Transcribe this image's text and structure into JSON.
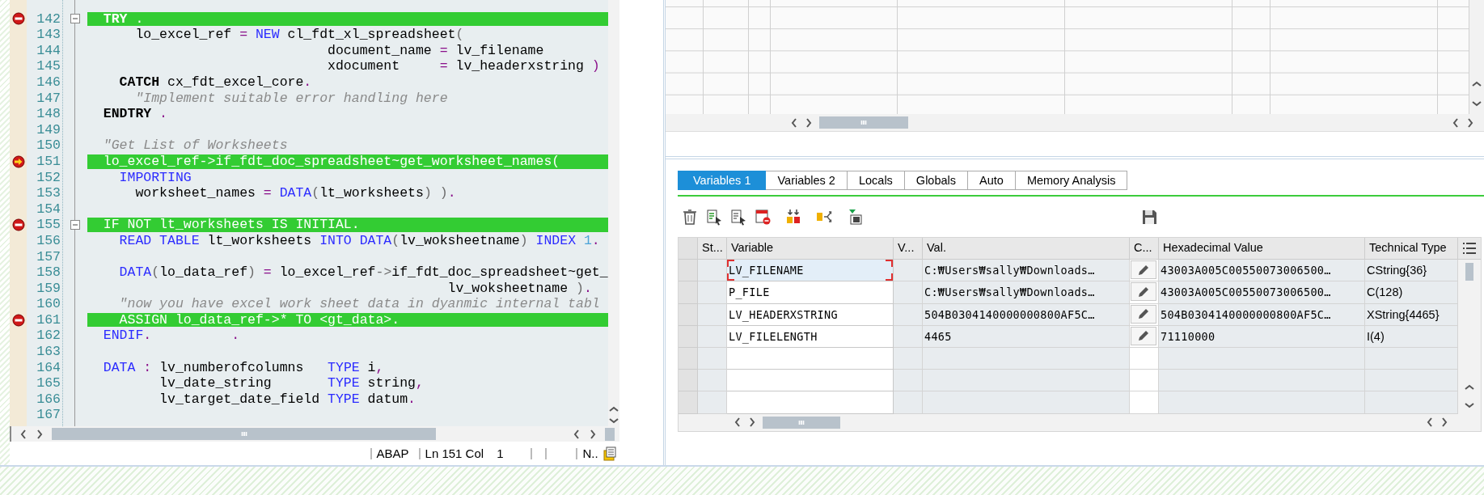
{
  "editor": {
    "lines": [
      {
        "number": "142",
        "highlighted": true,
        "breakpoint": true,
        "current_line": false,
        "collapsible": true,
        "segments": [
          {
            "text": "  TRY",
            "kind": "bold"
          },
          {
            "text": " .",
            "kind": "op"
          }
        ]
      },
      {
        "number": "143",
        "highlighted": false,
        "breakpoint": false,
        "current_line": false,
        "collapsible": false,
        "segments": [
          {
            "text": "      lo_excel_ref ",
            "kind": "ident"
          },
          {
            "text": "=",
            "kind": "op"
          },
          {
            "text": " NEW",
            "kind": "keyword"
          },
          {
            "text": " cl_fdt_xl_spreadsheet",
            "kind": "ident"
          },
          {
            "text": "(",
            "kind": "paren"
          }
        ]
      },
      {
        "number": "144",
        "highlighted": false,
        "breakpoint": false,
        "current_line": false,
        "collapsible": false,
        "segments": [
          {
            "text": "                              document_name ",
            "kind": "ident"
          },
          {
            "text": "=",
            "kind": "op"
          },
          {
            "text": " lv_filename",
            "kind": "ident"
          }
        ]
      },
      {
        "number": "145",
        "highlighted": false,
        "breakpoint": false,
        "current_line": false,
        "collapsible": false,
        "segments": [
          {
            "text": "                              xdocument     ",
            "kind": "ident"
          },
          {
            "text": "=",
            "kind": "op"
          },
          {
            "text": " lv_headerxstring ",
            "kind": "ident"
          },
          {
            "text": ")",
            "kind": "op"
          }
        ]
      },
      {
        "number": "146",
        "highlighted": false,
        "breakpoint": false,
        "current_line": false,
        "collapsible": false,
        "segments": [
          {
            "text": "    CATCH",
            "kind": "bold"
          },
          {
            "text": " cx_fdt_excel_core",
            "kind": "ident"
          },
          {
            "text": ".",
            "kind": "op"
          }
        ]
      },
      {
        "number": "147",
        "highlighted": false,
        "breakpoint": false,
        "current_line": false,
        "collapsible": false,
        "segments": [
          {
            "text": "      \"Implement suitable error handling here",
            "kind": "comment"
          }
        ]
      },
      {
        "number": "148",
        "highlighted": false,
        "breakpoint": false,
        "current_line": false,
        "collapsible": false,
        "segments": [
          {
            "text": "  ENDTRY",
            "kind": "bold"
          },
          {
            "text": " .",
            "kind": "op"
          }
        ]
      },
      {
        "number": "149",
        "highlighted": false,
        "breakpoint": false,
        "current_line": false,
        "collapsible": false
      },
      {
        "number": "150",
        "highlighted": false,
        "breakpoint": false,
        "current_line": false,
        "collapsible": false,
        "segments": [
          {
            "text": "  \"Get List of Worksheets",
            "kind": "comment"
          }
        ]
      },
      {
        "number": "151",
        "highlighted": true,
        "breakpoint": false,
        "current_line": true,
        "collapsible": false,
        "segments": [
          {
            "text": "  lo_excel_ref->if_fdt_doc_spreadsheet~get_worksheet_names(",
            "kind": "ident"
          }
        ]
      },
      {
        "number": "152",
        "highlighted": false,
        "breakpoint": false,
        "current_line": false,
        "collapsible": false,
        "segments": [
          {
            "text": "    IMPORTING",
            "kind": "keyword"
          }
        ]
      },
      {
        "number": "153",
        "highlighted": false,
        "breakpoint": false,
        "current_line": false,
        "collapsible": false,
        "segments": [
          {
            "text": "      worksheet_names ",
            "kind": "ident"
          },
          {
            "text": "=",
            "kind": "op"
          },
          {
            "text": " DATA",
            "kind": "keyword"
          },
          {
            "text": "(",
            "kind": "paren"
          },
          {
            "text": "lt_worksheets",
            "kind": "ident"
          },
          {
            "text": ") )",
            "kind": "paren"
          },
          {
            "text": ".",
            "kind": "op"
          }
        ]
      },
      {
        "number": "154",
        "highlighted": false,
        "breakpoint": false,
        "current_line": false,
        "collapsible": false
      },
      {
        "number": "155",
        "highlighted": true,
        "breakpoint": true,
        "current_line": false,
        "collapsible": true,
        "segments": [
          {
            "text": "  IF NOT lt_worksheets IS INITIAL.",
            "kind": "ident"
          }
        ]
      },
      {
        "number": "156",
        "highlighted": false,
        "breakpoint": false,
        "current_line": false,
        "collapsible": false,
        "segments": [
          {
            "text": "    READ TABLE",
            "kind": "keyword"
          },
          {
            "text": " lt_worksheets ",
            "kind": "ident"
          },
          {
            "text": "INTO DATA",
            "kind": "keyword"
          },
          {
            "text": "(",
            "kind": "paren"
          },
          {
            "text": "lv_woksheetname",
            "kind": "ident"
          },
          {
            "text": ")",
            "kind": "paren"
          },
          {
            "text": " INDEX",
            "kind": "keyword"
          },
          {
            "text": " 1",
            "kind": "number"
          },
          {
            "text": ".",
            "kind": "op"
          }
        ]
      },
      {
        "number": "157",
        "highlighted": false,
        "breakpoint": false,
        "current_line": false,
        "collapsible": false
      },
      {
        "number": "158",
        "highlighted": false,
        "breakpoint": false,
        "current_line": false,
        "collapsible": false,
        "segments": [
          {
            "text": "    DATA",
            "kind": "keyword"
          },
          {
            "text": "(",
            "kind": "paren"
          },
          {
            "text": "lo_data_ref",
            "kind": "ident"
          },
          {
            "text": ")",
            "kind": "paren"
          },
          {
            "text": " =",
            "kind": "op"
          },
          {
            "text": " lo_excel_ref",
            "kind": "ident"
          },
          {
            "text": "->",
            "kind": "paren"
          },
          {
            "text": "if_fdt_doc_spreadsheet~get_",
            "kind": "ident"
          }
        ]
      },
      {
        "number": "159",
        "highlighted": false,
        "breakpoint": false,
        "current_line": false,
        "collapsible": false,
        "segments": [
          {
            "text": "                                             lv_woksheetname ",
            "kind": "ident"
          },
          {
            "text": ")",
            "kind": "paren"
          },
          {
            "text": ".",
            "kind": "op"
          }
        ]
      },
      {
        "number": "160",
        "highlighted": false,
        "breakpoint": false,
        "current_line": false,
        "collapsible": false,
        "segments": [
          {
            "text": "    \"now you have excel work sheet data in dyanmic internal tabl",
            "kind": "comment"
          }
        ]
      },
      {
        "number": "161",
        "highlighted": true,
        "breakpoint": true,
        "current_line": false,
        "collapsible": false,
        "segments": [
          {
            "text": "    ASSIGN lo_data_ref->* TO <gt_data>.",
            "kind": "ident"
          }
        ]
      },
      {
        "number": "162",
        "highlighted": false,
        "breakpoint": false,
        "current_line": false,
        "collapsible": false,
        "segments": [
          {
            "text": "  ENDIF",
            "kind": "keyword"
          },
          {
            "text": ".          .",
            "kind": "op"
          }
        ]
      },
      {
        "number": "163",
        "highlighted": false,
        "breakpoint": false,
        "current_line": false,
        "collapsible": false
      },
      {
        "number": "164",
        "highlighted": false,
        "breakpoint": false,
        "current_line": false,
        "collapsible": false,
        "segments": [
          {
            "text": "  DATA",
            "kind": "keyword"
          },
          {
            "text": " :",
            "kind": "op"
          },
          {
            "text": " lv_numberofcolumns   ",
            "kind": "ident"
          },
          {
            "text": "TYPE",
            "kind": "keyword"
          },
          {
            "text": " i",
            "kind": "ident"
          },
          {
            "text": ",",
            "kind": "op"
          }
        ]
      },
      {
        "number": "165",
        "highlighted": false,
        "breakpoint": false,
        "current_line": false,
        "collapsible": false,
        "segments": [
          {
            "text": "         lv_date_string       ",
            "kind": "ident"
          },
          {
            "text": "TYPE",
            "kind": "keyword"
          },
          {
            "text": " string",
            "kind": "ident"
          },
          {
            "text": ",",
            "kind": "op"
          }
        ]
      },
      {
        "number": "166",
        "highlighted": false,
        "breakpoint": false,
        "current_line": false,
        "collapsible": false,
        "segments": [
          {
            "text": "         lv_target_date_field ",
            "kind": "ident"
          },
          {
            "text": "TYPE",
            "kind": "keyword"
          },
          {
            "text": " datum",
            "kind": "ident"
          },
          {
            "text": ".",
            "kind": "op"
          }
        ]
      },
      {
        "number": "167",
        "highlighted": false,
        "breakpoint": false,
        "current_line": false,
        "collapsible": false
      }
    ]
  },
  "status_bar": {
    "language": "ABAP",
    "position": "Ln 151 Col",
    "column": "1",
    "mode": "N.."
  },
  "debugger": {
    "tabs": [
      {
        "label": "Variables 1",
        "selected": true
      },
      {
        "label": "Variables 2",
        "selected": false
      },
      {
        "label": "Locals",
        "selected": false
      },
      {
        "label": "Globals",
        "selected": false
      },
      {
        "label": "Auto",
        "selected": false
      },
      {
        "label": "Memory Analysis",
        "selected": false
      }
    ],
    "table": {
      "columns": [
        "St...",
        "Variable",
        "V...",
        "Val.",
        "C...",
        "Hexadecimal Value",
        "Technical Type"
      ],
      "rows": [
        {
          "selected": true,
          "variable": "LV_FILENAME",
          "value": "C:₩Users₩sally₩Downloads…",
          "editable": true,
          "hex": "43003A005C00550073006500…",
          "technical_type": "CString{36}"
        },
        {
          "selected": false,
          "variable": "P_FILE",
          "value": "C:₩Users₩sally₩Downloads…",
          "editable": true,
          "hex": "43003A005C00550073006500…",
          "technical_type": "C(128)"
        },
        {
          "selected": false,
          "variable": "LV_HEADERXSTRING",
          "value": "504B0304140000000800AF5C…",
          "editable": true,
          "hex": "504B0304140000000800AF5C…",
          "technical_type": "XString{4465}"
        },
        {
          "selected": false,
          "variable": "LV_FILELENGTH",
          "value": "4465",
          "editable": true,
          "hex": "71110000",
          "technical_type": "I(4)"
        }
      ]
    }
  }
}
